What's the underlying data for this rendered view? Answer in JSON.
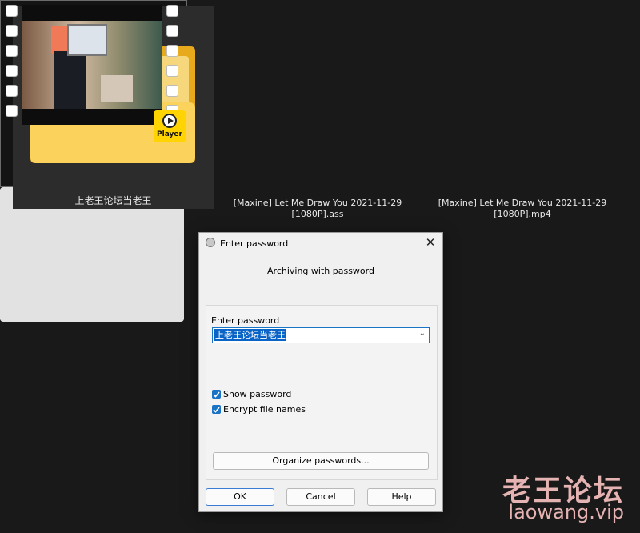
{
  "files": [
    {
      "name": "上老王论坛当老王",
      "type": "folder"
    },
    {
      "name_line1": "[Maxine] Let Me Draw You 2021-11-29",
      "name_line2": "[1080P].ass",
      "type": "subtitle"
    },
    {
      "name_line1": "[Maxine] Let Me Draw You 2021-11-29",
      "name_line2": "[1080P].mp4",
      "type": "video",
      "badge": "Player"
    }
  ],
  "dialog": {
    "title": "Enter password",
    "subtitle": "Archiving with password",
    "password_label": "Enter password",
    "password_value": "上老王论坛当老王",
    "show_password_label": "Show password",
    "show_password_checked": true,
    "encrypt_names_label": "Encrypt file names",
    "encrypt_names_checked": true,
    "organize_label": "Organize passwords...",
    "ok_label": "OK",
    "cancel_label": "Cancel",
    "help_label": "Help"
  },
  "watermark": {
    "line1": "老王论坛",
    "line2": "laowang.vip"
  },
  "colors": {
    "background": "#191919",
    "accent": "#1a73c4",
    "folder": "#f5c242",
    "badge": "#ffd400"
  }
}
